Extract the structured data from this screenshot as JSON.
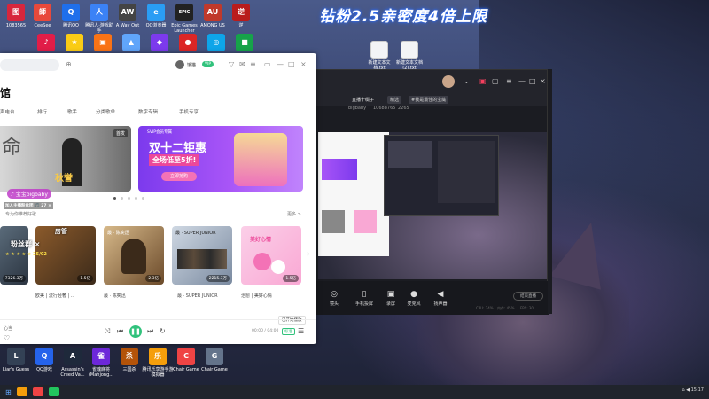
{
  "overlay": {
    "banner_text": "钻粉2.5亲密度4倍上限"
  },
  "desktop": {
    "top_icons": [
      {
        "label": "1083565",
        "color": "#d7263d",
        "glyph": "图"
      },
      {
        "label": "CeeSee",
        "color": "#e8493b",
        "glyph": "師"
      },
      {
        "label": "腾讯QQ",
        "color": "#1f6feb",
        "glyph": "Q"
      },
      {
        "label": "腾讯人·游戏助手",
        "color": "#3b82f6",
        "glyph": "人"
      },
      {
        "label": "A Way Out",
        "color": "#444444",
        "glyph": "AW"
      },
      {
        "label": "QQ浏览器",
        "color": "#2a9df4",
        "glyph": "e"
      },
      {
        "label": "Epic Games Launcher",
        "color": "#222222",
        "glyph": "EPIC"
      },
      {
        "label": "AMONG US",
        "color": "#c0392b",
        "glyph": "AU"
      },
      {
        "label": "逆",
        "color": "#b91c1c",
        "glyph": "逆"
      }
    ],
    "second_row_icons": [
      {
        "label": "",
        "color": "#e11d48",
        "glyph": "♪"
      },
      {
        "label": "",
        "color": "#facc15",
        "glyph": "★"
      },
      {
        "label": "",
        "color": "#f97316",
        "glyph": "▣"
      },
      {
        "label": "",
        "color": "#60a5fa",
        "glyph": "▲"
      },
      {
        "label": "",
        "color": "#7c3aed",
        "glyph": "◆"
      },
      {
        "label": "",
        "color": "#dc2626",
        "glyph": "●"
      },
      {
        "label": "",
        "color": "#0ea5e9",
        "glyph": "◎"
      },
      {
        "label": "",
        "color": "#16a34a",
        "glyph": "■"
      }
    ],
    "file_icons": [
      {
        "label": "新建文本文档.txt"
      },
      {
        "label": "新建文本文档(2).txt"
      }
    ],
    "bottom_icons": [
      {
        "label": "Liar's Guess",
        "color": "#334155",
        "glyph": "L"
      },
      {
        "label": "QQ游戏",
        "color": "#2563eb",
        "glyph": "Q"
      },
      {
        "label": "Assassin's Creed Va...",
        "color": "#1e293b",
        "glyph": "A"
      },
      {
        "label": "雀魂麻将 (Mahjong...",
        "color": "#6d28d9",
        "glyph": "雀"
      },
      {
        "label": "三国杀",
        "color": "#b45309",
        "glyph": "杀"
      },
      {
        "label": "腾讯乐享游手游模拟器",
        "color": "#f59e0b",
        "glyph": "乐"
      },
      {
        "label": "Chair Game",
        "color": "#ef4444",
        "glyph": "C"
      },
      {
        "label": "Chair Game",
        "color": "#64748b",
        "glyph": "G"
      }
    ]
  },
  "qq_music": {
    "search_placeholder": "",
    "user_name": "饿猫",
    "vip_badge": "VIP",
    "title_partial": "馆",
    "tabs": [
      "声电台",
      "排行",
      "歌手",
      "分类歌单",
      "数字专辑",
      "手机专享"
    ],
    "banner1_caption": "秋誉",
    "banner1_tag": "首发",
    "banner2_title_line1": "双十二钜惠",
    "banner2_title_line2": "全场低至5折!",
    "banner2_tag": "SVIP会员专属",
    "banner2_button": "立即抢购",
    "section_more": "更多 >",
    "section_hint": "专为你推荐好歌",
    "cards": [
      {
        "caption": "...",
        "count": "7326.3万",
        "color1": "#5a6b7a",
        "color2": "#2b3440"
      },
      {
        "caption": "欧美 | 流行轻奢 | ...",
        "count": "1.5亿",
        "color1": "#8b5a2b",
        "color2": "#3b2a1a"
      },
      {
        "caption": "最 · 陈奕迅",
        "count": "2.3亿",
        "color1": "#d7b98a",
        "color2": "#6b4a2a"
      },
      {
        "caption": "最 · SUPER JUNIOR",
        "count": "2215.3万",
        "color1": "#cfd8e3",
        "color2": "#7a8aa0"
      },
      {
        "caption": "治愈 | 美好心情",
        "count": "1.5亿",
        "color1": "#fbcfe8",
        "color2": "#f472b6"
      }
    ],
    "card3_title": "最 · 陈奕迅",
    "card4_title": "最 · SUPER JUNIOR",
    "card5_title": "美好心情",
    "tooltip": "已开始播放",
    "time": "00:00 / 04:00",
    "quality": "标准",
    "status_text": "心当"
  },
  "stream_app": {
    "room_label": "直播十缀子",
    "tag1": "精选",
    "tag2": "#我是最佳的宝藏",
    "anchor": "bigbaby",
    "anchor_id": "10688765",
    "fans": "2265",
    "toolbar": [
      "镜头",
      "手机投屏",
      "录屏",
      "麦克风",
      "扬声器"
    ],
    "end_button": "结束直播",
    "footer_stats": [
      "CPU: 24%",
      "内存: 45%",
      "FPS: 30"
    ]
  },
  "stream_overlay": {
    "name_tag": "宝宝bigbaby",
    "line1": "加入主播粉丝团 🎵 27 ×",
    "line2": "粉丝群 ×",
    "line3": "房管",
    "line4": "★ ★ ★ ★ ★ 25/02",
    "name2": "粉丝群 2582"
  },
  "taskbar": {
    "time": "15:17"
  }
}
